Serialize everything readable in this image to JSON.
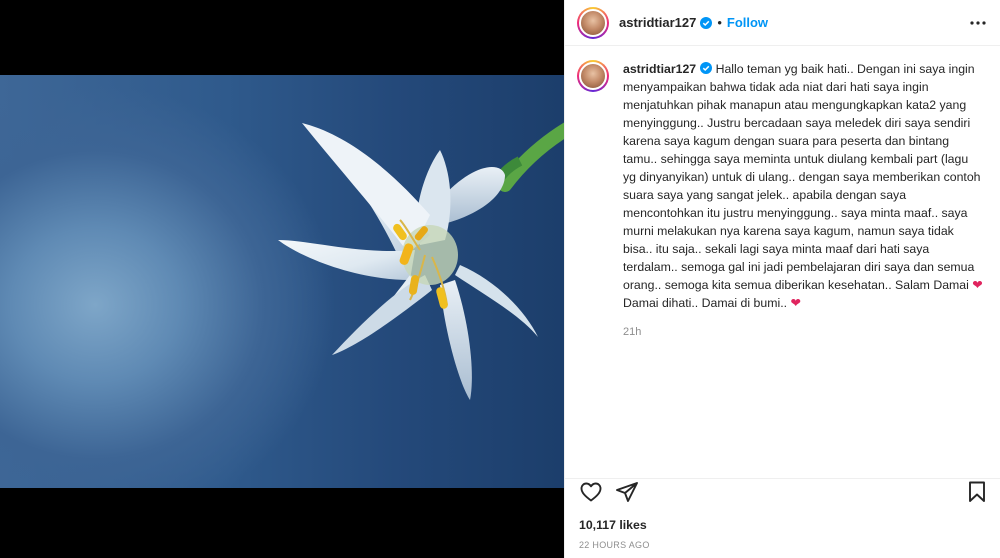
{
  "post": {
    "username": "astridtiar127",
    "follow_label": "Follow",
    "separator": "•",
    "caption": "Hallo teman yg baik hati.. Dengan ini saya ingin menyampaikan bahwa tidak ada niat dari hati saya ingin menjatuhkan pihak manapun atau mengungkapkan kata2 yang menyinggung.. Justru bercadaan saya meledek diri saya sendiri karena saya kagum dengan suara para peserta dan bintang tamu.. sehingga saya meminta untuk diulang kembali part (lagu yg dinyanyikan) untuk di ulang.. dengan saya memberikan contoh suara saya yang sangat jelek.. apabila dengan saya mencontohkan itu justru menyinggung.. saya minta maaf.. saya murni melakukan nya karena saya kagum, namun saya tidak bisa.. itu saja.. sekali lagi saya minta maaf dari hati saya terdalam.. semoga gal ini jadi pembelajaran diri saya dan semua orang.. semoga kita semua diberikan kesehatan.. Salam Damai",
    "caption_end": "Damai dihati.. Damai di bumi..",
    "heart_emoji": "❤",
    "caption_age": "21h",
    "likes": "10,117 likes",
    "posted_ago": "22 HOURS AGO"
  },
  "icons": {
    "verified": "verified-badge-icon",
    "more": "more-options-icon",
    "like": "heart-outline-icon",
    "share": "paper-plane-icon",
    "save": "bookmark-icon"
  },
  "colors": {
    "accent": "#0095f6",
    "heart": "#e0245e",
    "muted": "#8e8e8e",
    "photo_bg": "#2f5a8c"
  }
}
